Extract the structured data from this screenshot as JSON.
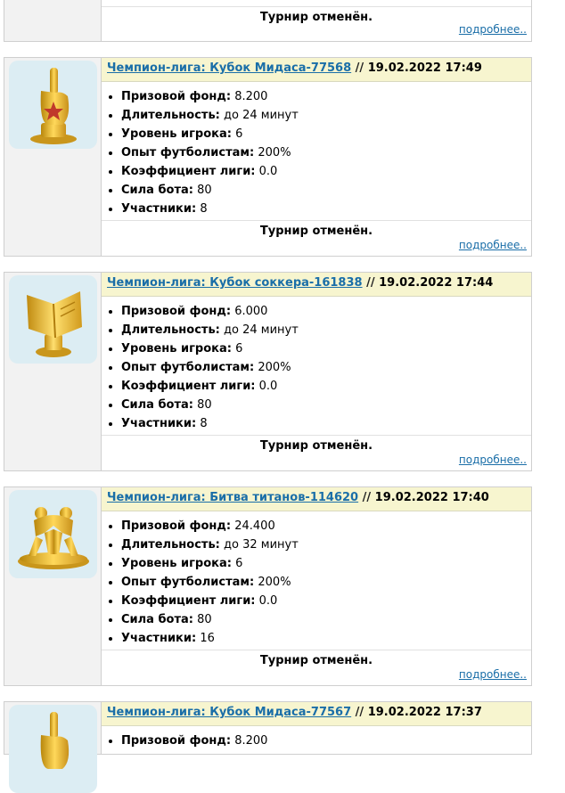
{
  "partial_top": {
    "status": "Турнир отменён.",
    "more": "подробнее.."
  },
  "tournaments": [
    {
      "title": "Чемпион-лига: Кубок Мидаса-77568",
      "sep": " // ",
      "date": "19.02.2022 17:49",
      "icon": "golden-finger-trophy-icon",
      "fields": [
        {
          "label": "Призовой фонд:",
          "value": "8.200"
        },
        {
          "label": "Длительность:",
          "value": "до 24 минут"
        },
        {
          "label": "Уровень игрока:",
          "value": "6"
        },
        {
          "label": "Опыт футболистам:",
          "value": "200%"
        },
        {
          "label": "Коэффициент лиги:",
          "value": "0.0"
        },
        {
          "label": "Сила бота:",
          "value": "80"
        },
        {
          "label": "Участники:",
          "value": "8"
        }
      ],
      "status": "Турнир отменён.",
      "more": "подробнее.."
    },
    {
      "title": "Чемпион-лига: Кубок соккера-161838",
      "sep": " // ",
      "date": "19.02.2022 17:44",
      "icon": "golden-book-trophy-icon",
      "fields": [
        {
          "label": "Призовой фонд:",
          "value": "6.000"
        },
        {
          "label": "Длительность:",
          "value": "до 24 минут"
        },
        {
          "label": "Уровень игрока:",
          "value": "6"
        },
        {
          "label": "Опыт футболистам:",
          "value": "200%"
        },
        {
          "label": "Коэффициент лиги:",
          "value": "0.0"
        },
        {
          "label": "Сила бота:",
          "value": "80"
        },
        {
          "label": "Участники:",
          "value": "8"
        }
      ],
      "status": "Турнир отменён.",
      "more": "подробнее.."
    },
    {
      "title": "Чемпион-лига: Битва титанов-114620",
      "sep": " // ",
      "date": "19.02.2022 17:40",
      "icon": "golden-wrestlers-trophy-icon",
      "fields": [
        {
          "label": "Призовой фонд:",
          "value": "24.400"
        },
        {
          "label": "Длительность:",
          "value": "до 32 минут"
        },
        {
          "label": "Уровень игрока:",
          "value": "6"
        },
        {
          "label": "Опыт футболистам:",
          "value": "200%"
        },
        {
          "label": "Коэффициент лиги:",
          "value": "0.0"
        },
        {
          "label": "Сила бота:",
          "value": "80"
        },
        {
          "label": "Участники:",
          "value": "16"
        }
      ],
      "status": "Турнир отменён.",
      "more": "подробнее.."
    },
    {
      "title": "Чемпион-лига: Кубок Мидаса-77567",
      "sep": " // ",
      "date": "19.02.2022 17:37",
      "icon": "golden-finger-trophy-icon",
      "fields": [
        {
          "label": "Призовой фонд:",
          "value": "8.200"
        }
      ]
    }
  ],
  "colors": {
    "header_bg": "#f7f5cf",
    "link": "#1a6ea8",
    "icon_bg": "#dcedf3",
    "gold": "#e8b830"
  }
}
